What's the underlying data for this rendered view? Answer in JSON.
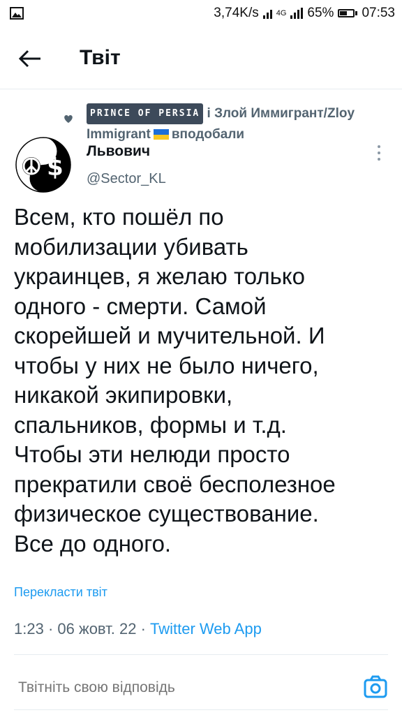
{
  "status_bar": {
    "speed": "3,74K/s",
    "network": "4G",
    "battery": "65%",
    "battery_level": 0.65,
    "time": "07:53"
  },
  "header": {
    "title": "Твіт",
    "back_icon": "arrow-left-icon"
  },
  "context": {
    "icon": "heart-icon",
    "liker_fancy": "PRINCE OF PERSIA",
    "conj": " і ",
    "liker2": "Злой Иммигрант/Zloy Immigrant",
    "flag": "ukraine-flag-icon",
    "action": "вподобали"
  },
  "author": {
    "name": "Львович",
    "handle": "@Sector_KL",
    "avatar_icon": "peace-dollar-yin-yang-avatar"
  },
  "tweet": {
    "text": "Всем, кто пошёл по\nмобилизации убивать\nукраинцев, я желаю только\nодного - смерти. Самой\nскорейшей и мучительной. И\nчтобы у них не было ничего,\nникакой экипировки,\nспальников, формы и т.д.\nЧтобы эти нелюди просто\nпрекратили своё бесполезное\nфизическое существование.\nВсе до одного.",
    "translate": "Перекласти твіт",
    "time": "1:23",
    "sep": " · ",
    "date": "06 жовт. 22",
    "app": "Twitter Web App"
  },
  "reply": {
    "placeholder": "Твітніть свою відповідь",
    "camera_icon": "camera-icon"
  },
  "colors": {
    "accent": "#1d9bf0",
    "secondary_text": "#536471",
    "text": "#0f1419"
  }
}
